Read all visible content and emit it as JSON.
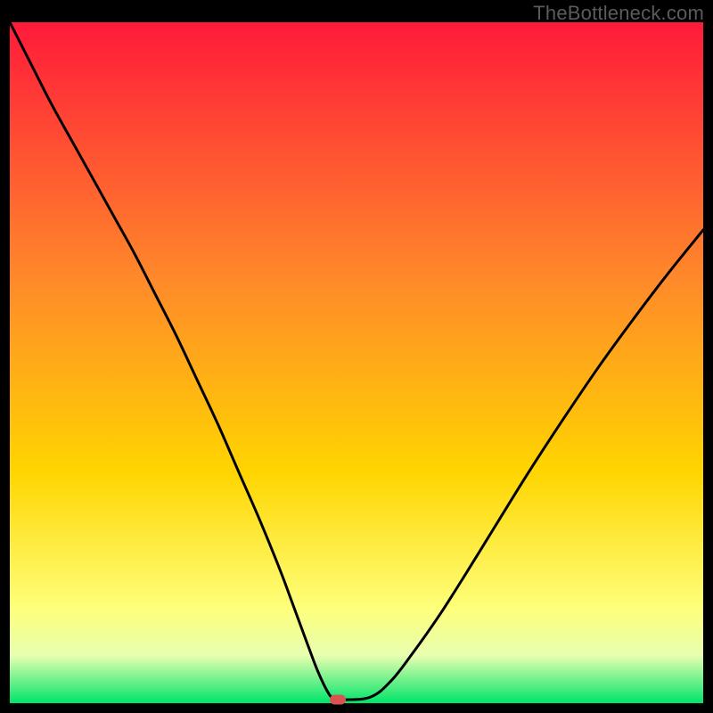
{
  "watermark": "TheBottleneck.com",
  "colors": {
    "gradient_top": "#ff1a3a",
    "gradient_mid1": "#ff6a2a",
    "gradient_mid2": "#ffd500",
    "gradient_mid3": "#feff7a",
    "gradient_bottom": "#00e46a",
    "curve": "#000000",
    "marker": "#d9534f",
    "frame": "#000000"
  },
  "chart_data": {
    "type": "line",
    "title": "",
    "xlabel": "",
    "ylabel": "",
    "xlim": [
      0,
      100
    ],
    "ylim": [
      0,
      100
    ],
    "grid": false,
    "legend": false,
    "series": [
      {
        "name": "bottleneck-curve",
        "x": [
          0,
          3,
          6,
          9,
          12,
          15,
          18,
          21,
          24,
          27,
          30,
          33,
          36,
          39,
          41,
          43,
          44.5,
          46,
          47,
          48,
          52,
          55,
          58,
          62,
          66,
          70,
          75,
          80,
          85,
          90,
          95,
          100
        ],
        "y": [
          100,
          94,
          88,
          82.5,
          77,
          71.5,
          66,
          60,
          54,
          47.5,
          41,
          34,
          27,
          19.5,
          14,
          8.5,
          4.5,
          1.4,
          0.5,
          0.5,
          0.9,
          3.3,
          7.2,
          13,
          19.4,
          26,
          34.2,
          42,
          49.5,
          56.5,
          63.2,
          69.5
        ]
      }
    ],
    "marker": {
      "x": 47.3,
      "y": 0.5
    }
  }
}
